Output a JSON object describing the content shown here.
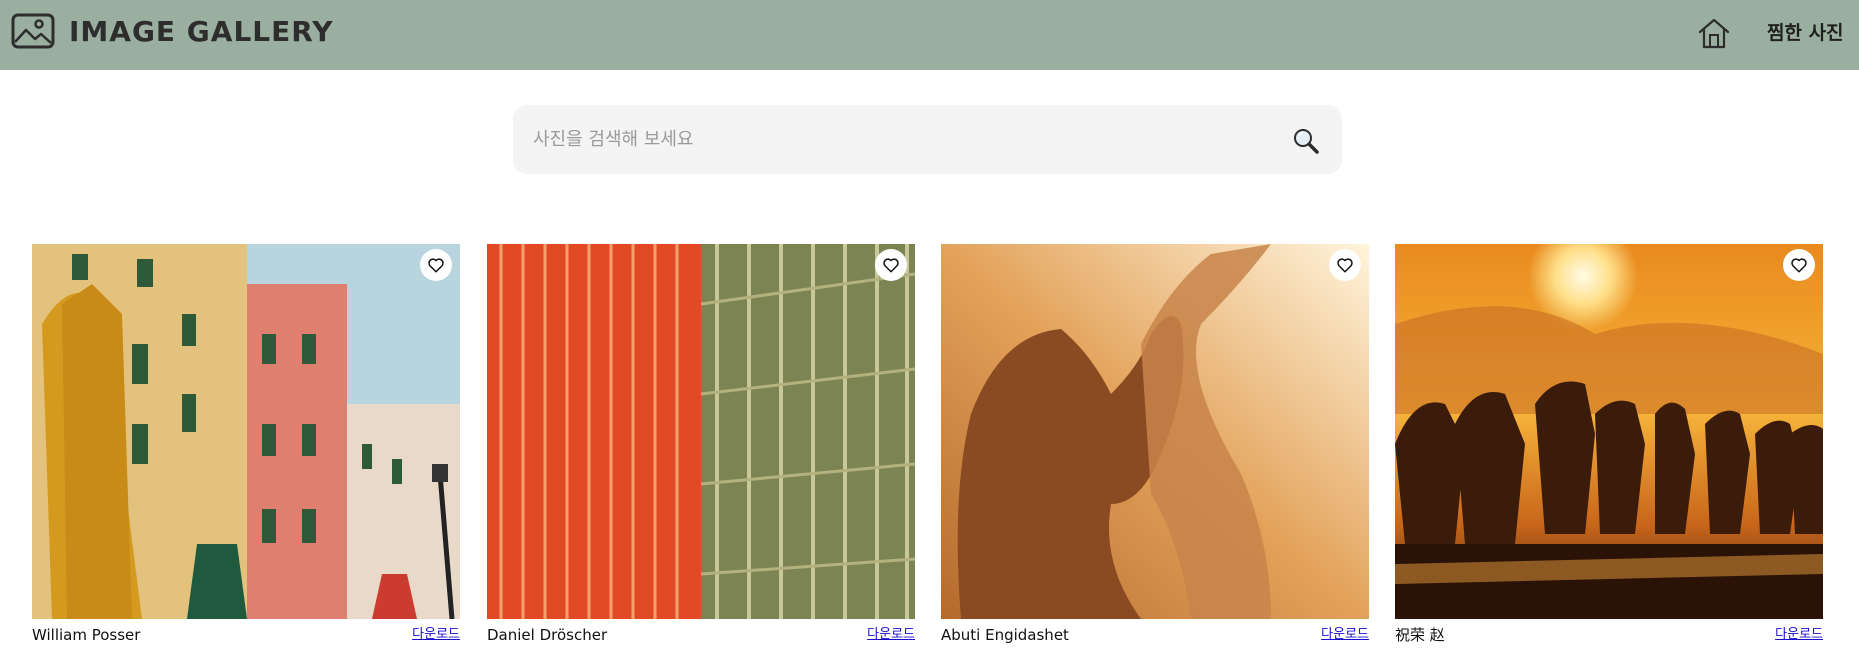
{
  "header": {
    "title": "IMAGE GALLERY",
    "logo_icon": "image-icon",
    "home_icon": "home-icon",
    "liked_label": "찜한 사진"
  },
  "search": {
    "placeholder": "사진을 검색해 보세요",
    "value": "",
    "icon": "magnifier-icon"
  },
  "gallery": {
    "cards": [
      {
        "author": "William Posser",
        "download_label": "다운로드",
        "liked": false
      },
      {
        "author": "Daniel Dröscher",
        "download_label": "다운로드",
        "liked": false
      },
      {
        "author": "Abuti Engidashet",
        "download_label": "다운로드",
        "liked": false
      },
      {
        "author": "祝荣 赵",
        "download_label": "다운로드",
        "liked": false
      }
    ]
  },
  "colors": {
    "header_bg": "#9aaf9f",
    "search_bg": "#f4f4f4",
    "link": "#1a0dcc"
  }
}
